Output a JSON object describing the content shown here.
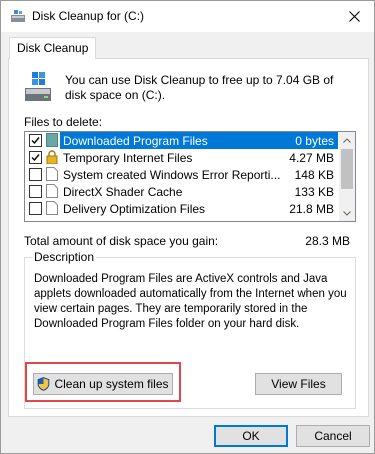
{
  "window": {
    "title": "Disk Cleanup for  (C:)",
    "tab": "Disk Cleanup"
  },
  "intro_text": "You can use Disk Cleanup to free up to 7.04 GB of disk space on  (C:).",
  "files_label": "Files to delete:",
  "files": [
    {
      "name": "Downloaded Program Files",
      "size": "0 bytes",
      "checked": true,
      "selected": true,
      "icon": "folder-icon"
    },
    {
      "name": "Temporary Internet Files",
      "size": "4.27 MB",
      "checked": true,
      "selected": false,
      "icon": "lock-icon"
    },
    {
      "name": "System created Windows Error Reporti...",
      "size": "148 KB",
      "checked": false,
      "selected": false,
      "icon": "file-icon"
    },
    {
      "name": "DirectX Shader Cache",
      "size": "133 KB",
      "checked": false,
      "selected": false,
      "icon": "file-icon"
    },
    {
      "name": "Delivery Optimization Files",
      "size": "21.8 MB",
      "checked": false,
      "selected": false,
      "icon": "file-icon"
    }
  ],
  "total_label": "Total amount of disk space you gain:",
  "total_value": "28.3 MB",
  "description": {
    "legend": "Description",
    "text": "Downloaded Program Files are ActiveX controls and Java applets downloaded automatically from the Internet when you view certain pages. They are temporarily stored in the Downloaded Program Files folder on your hard disk."
  },
  "buttons": {
    "cleanup": "Clean up system files",
    "view": "View Files",
    "ok": "OK",
    "cancel": "Cancel"
  },
  "colors": {
    "selection": "#0078d7",
    "highlight": "#e0474c"
  }
}
